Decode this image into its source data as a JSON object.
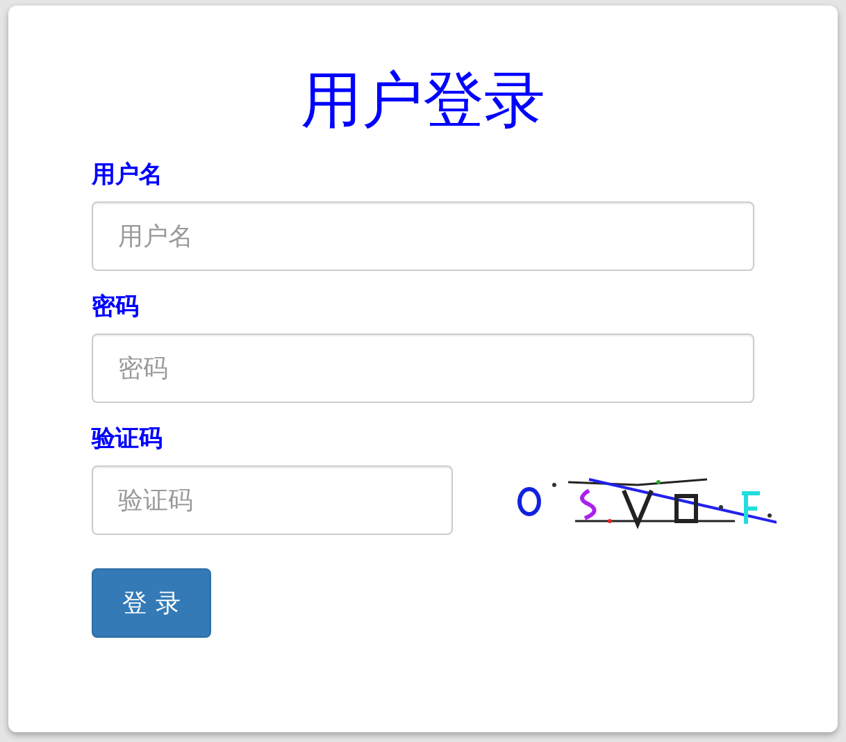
{
  "title": "用户登录",
  "fields": [
    {
      "label": "用户名",
      "placeholder": "用户名",
      "kind": "text"
    },
    {
      "label": "密码",
      "placeholder": "密码",
      "kind": "password"
    },
    {
      "label": "验证码",
      "placeholder": "验证码",
      "kind": "captcha"
    }
  ],
  "button": "登 录"
}
